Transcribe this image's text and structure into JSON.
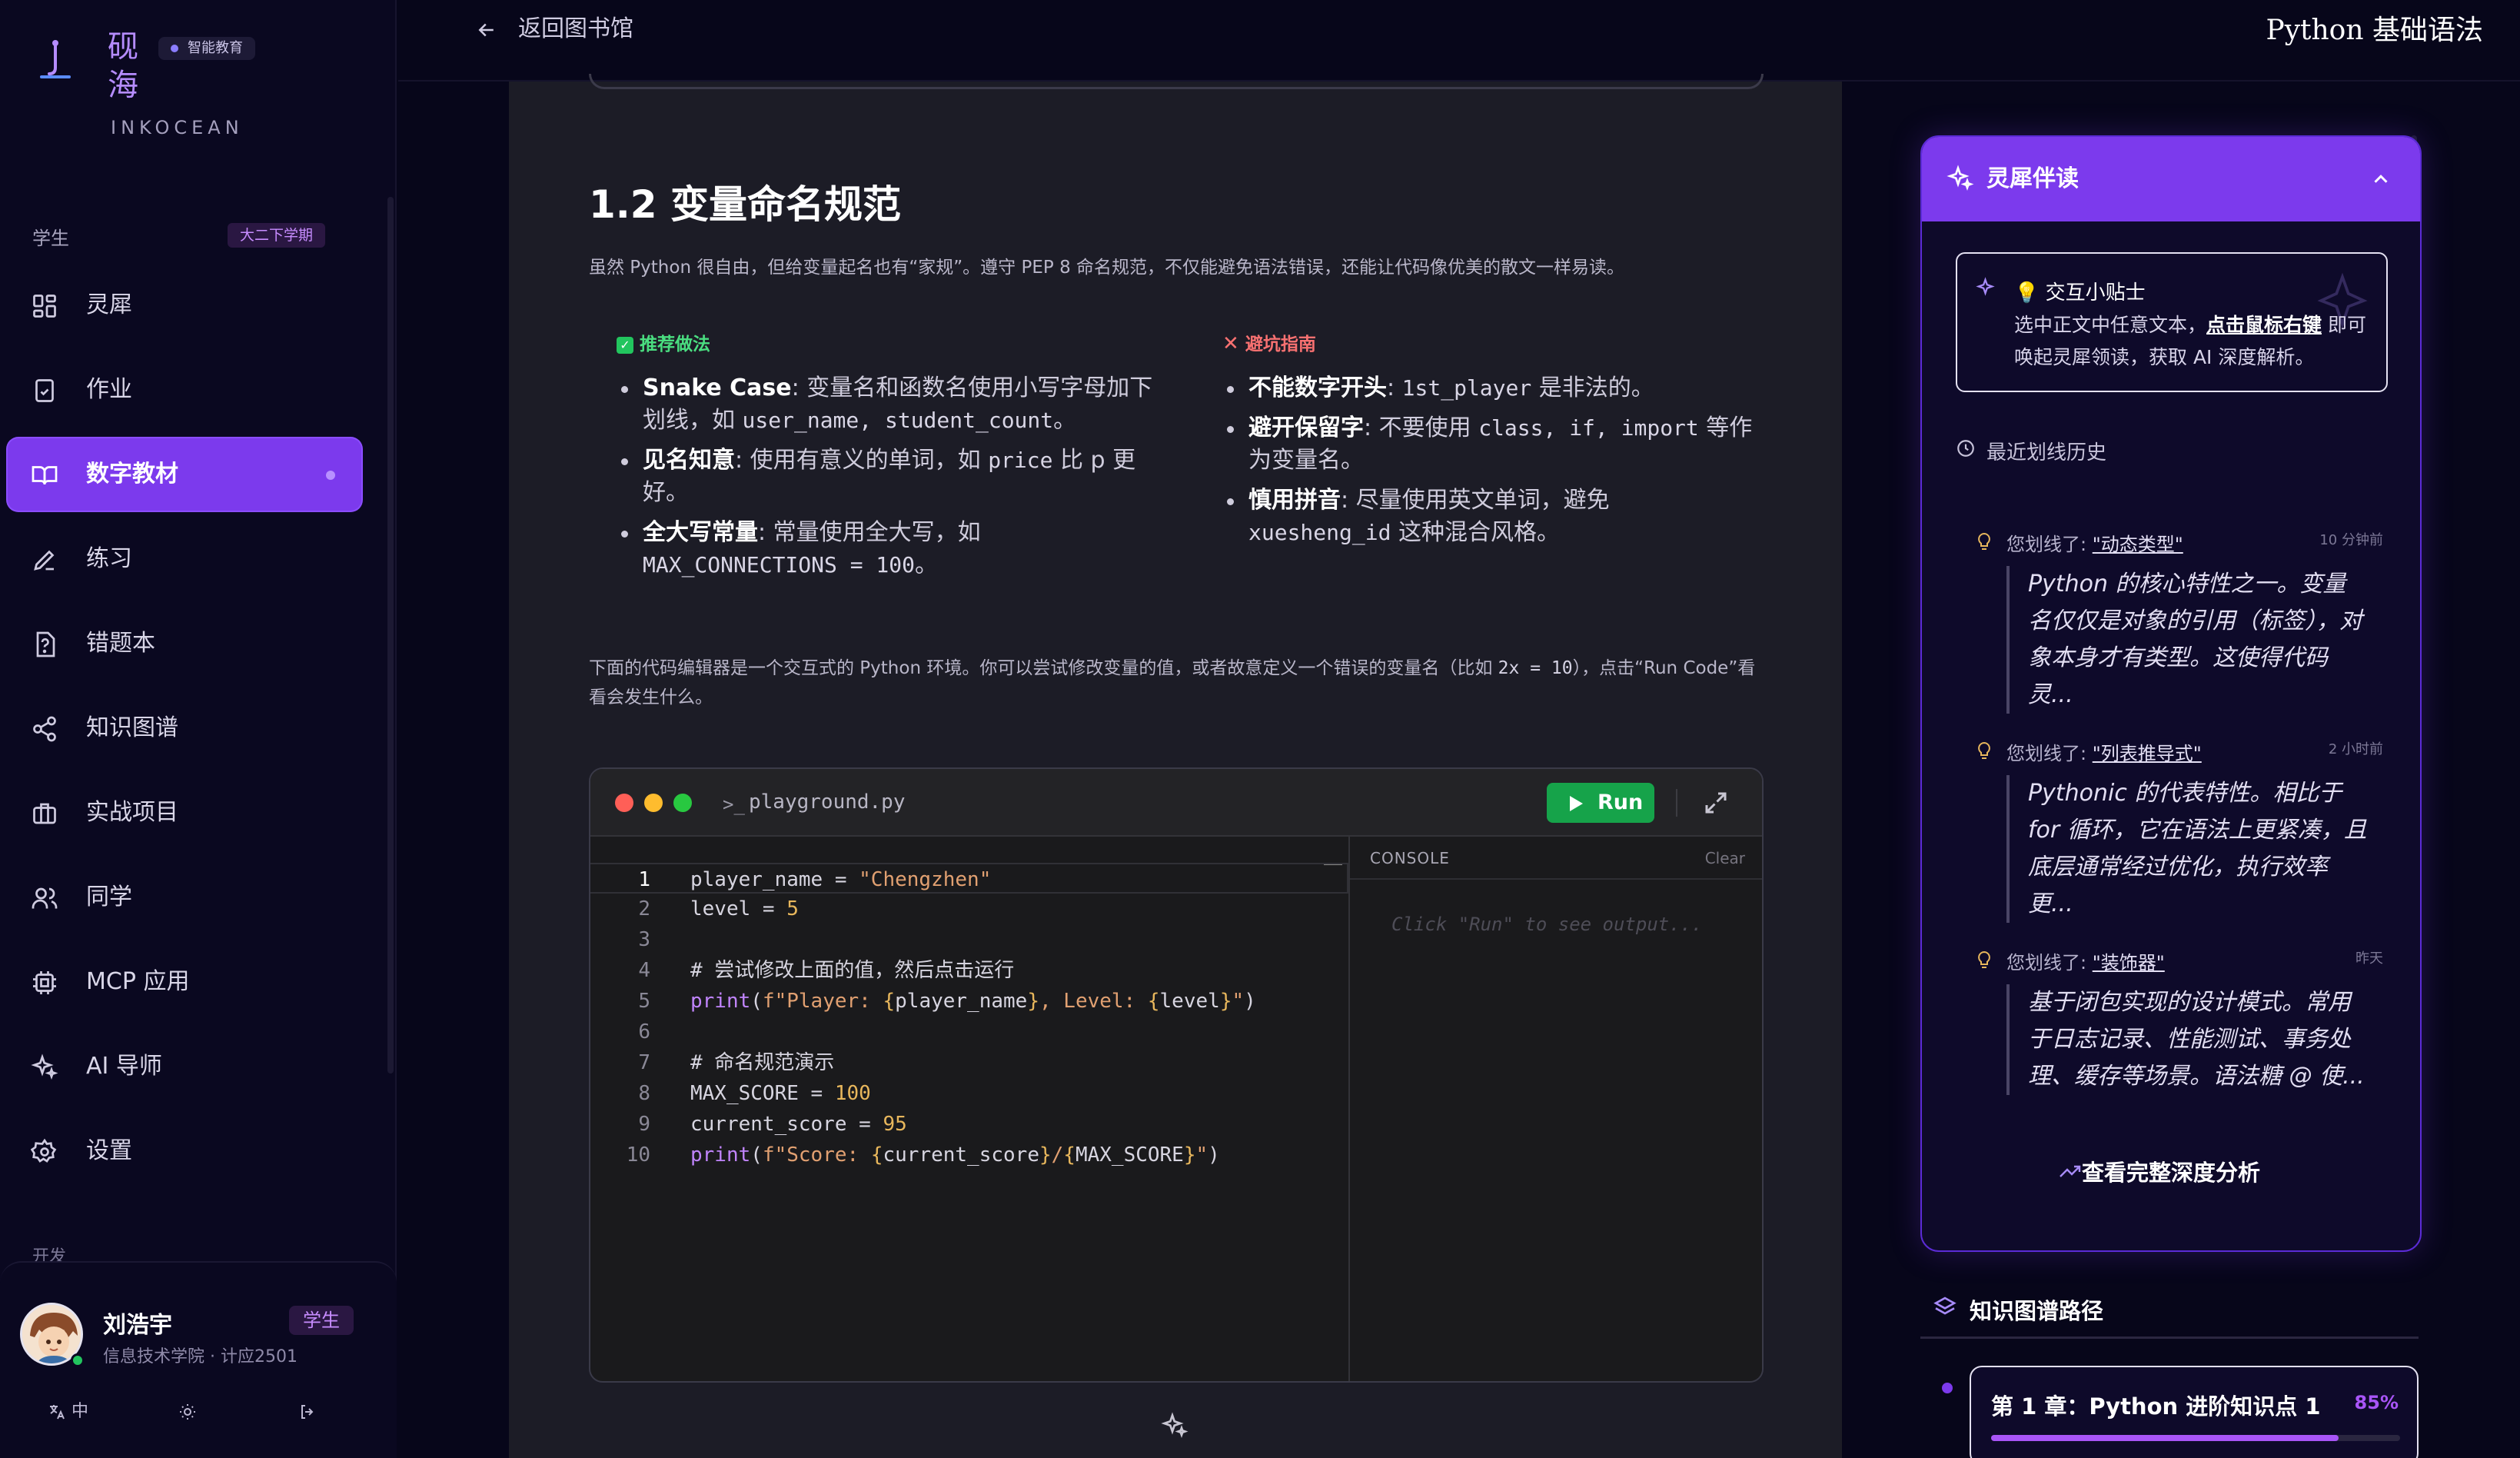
{
  "brand": {
    "name": "砚海",
    "badge": "智能教育",
    "subtitle": "INKOCEAN",
    "accent": "#7c3aed"
  },
  "sidebar": {
    "role_label": "学生",
    "term_badge": "大二下学期",
    "items": [
      {
        "label": "灵犀",
        "icon": "grid-icon",
        "active": false
      },
      {
        "label": "作业",
        "icon": "clipboard-check-icon",
        "active": false
      },
      {
        "label": "数字教材",
        "icon": "book-open-icon",
        "active": true
      },
      {
        "label": "练习",
        "icon": "pencil-icon",
        "active": false
      },
      {
        "label": "错题本",
        "icon": "question-file-icon",
        "active": false
      },
      {
        "label": "知识图谱",
        "icon": "share-nodes-icon",
        "active": false
      },
      {
        "label": "实战项目",
        "icon": "briefcase-icon",
        "active": false
      },
      {
        "label": "同学",
        "icon": "users-icon",
        "active": false
      },
      {
        "label": "MCP 应用",
        "icon": "chip-icon",
        "active": false
      },
      {
        "label": "AI 导师",
        "icon": "sparkles-icon",
        "active": false
      },
      {
        "label": "设置",
        "icon": "gear-icon",
        "active": false
      }
    ],
    "dev_label": "开发"
  },
  "user": {
    "name": "刘浩宇",
    "role": "学生",
    "school": "信息技术学院 · 计应2501",
    "lang": "中"
  },
  "topbar": {
    "back_label": "返回图书馆",
    "title": "Python 基础语法"
  },
  "content": {
    "section_title": "1.2 变量命名规范",
    "section_desc": "虽然 Python 很自由，但给变量起名也有“家规”。遵守 PEP 8 命名规范，不仅能避免语法错误，还能让代码像优美的散文一样易读。",
    "good": {
      "heading": "推荐做法",
      "items": [
        {
          "bold": "Snake Case",
          "rest_a": ": 变量名和函数名使用小写字母加下划线，如 ",
          "code": "user_name, student_count",
          "rest_b": "。"
        },
        {
          "bold": "见名知意",
          "rest_a": ": 使用有意义的单词，如 ",
          "code": "price",
          "rest_b": " 比 p 更好。"
        },
        {
          "bold": "全大写常量",
          "rest_a": ": 常量使用全大写，如 ",
          "code": "MAX_CONNECTIONS = 100",
          "rest_b": "。"
        }
      ]
    },
    "bad": {
      "heading": "避坑指南",
      "items": [
        {
          "bold": "不能数字开头",
          "rest_a": ": ",
          "code": "1st_player",
          "rest_b": " 是非法的。"
        },
        {
          "bold": "避开保留字",
          "rest_a": ": 不要使用 ",
          "code": "class, if, import",
          "rest_b": " 等作为变量名。"
        },
        {
          "bold": "慎用拼音",
          "rest_a": ": 尽量使用英文单词，避免 ",
          "code": "xuesheng_id",
          "rest_b": " 这种混合风格。"
        }
      ]
    },
    "para2_a": "下面的代码编辑器是一个交互式的 Python 环境。你可以尝试修改变量的值，或者故意定义一个错误的变量名（比如 ",
    "para2_code": "2x = 10",
    "para2_b": "），点击“Run Code”看看会发生什么。"
  },
  "editor": {
    "filename": "playground.py",
    "run_label": "Run",
    "console_title": "CONSOLE",
    "console_clear": "Clear",
    "console_placeholder": "Click \"Run\" to see output...",
    "lines": [
      "player_name = \"Chengzhen\"",
      "level = 5",
      "",
      "# 尝试修改上面的值，然后点击运行",
      "print(f\"Player: {player_name}, Level: {level}\")",
      "",
      "# 命名规范演示",
      "MAX_SCORE = 100",
      "current_score = 95",
      "print(f\"Score: {current_score}/{MAX_SCORE}\")"
    ],
    "colors": {
      "red": "#ff5f57",
      "yellow": "#febc2e",
      "green": "#28c840"
    }
  },
  "companion": {
    "title": "灵犀伴读",
    "tip_title": "💡 交互小贴士",
    "tip_body_a": "选中正文中任意文本，",
    "tip_body_bold": "点击鼠标右键",
    "tip_body_b": " 即可唤起灵犀领读，获取 AI 深度解析。",
    "history_title": "最近划线历史",
    "history": [
      {
        "prefix": "您划线了: ",
        "term": "\"动态类型\"",
        "time": "10 分钟前",
        "quote": "Python 的核心特性之一。变量名仅仅是对象的引用（标签），对象本身才有类型。这使得代码灵..."
      },
      {
        "prefix": "您划线了: ",
        "term": "\"列表推导式\"",
        "time": "2 小时前",
        "quote": "Pythonic 的代表特性。相比于 for 循环，它在语法上更紧凑，且底层通常经过优化，执行效率更..."
      },
      {
        "prefix": "您划线了: ",
        "term": "\"装饰器\"",
        "time": "昨天",
        "quote": "基于闭包实现的设计模式。常用于日志记录、性能测试、事务处理、缓存等场景。语法糖 @ 使..."
      }
    ],
    "deep_link": "查看完整深度分析"
  },
  "knowledge": {
    "title": "知识图谱路径",
    "chapter": "第 1 章：Python 进阶知识点 1",
    "progress_label": "85%",
    "progress": 0.85
  }
}
